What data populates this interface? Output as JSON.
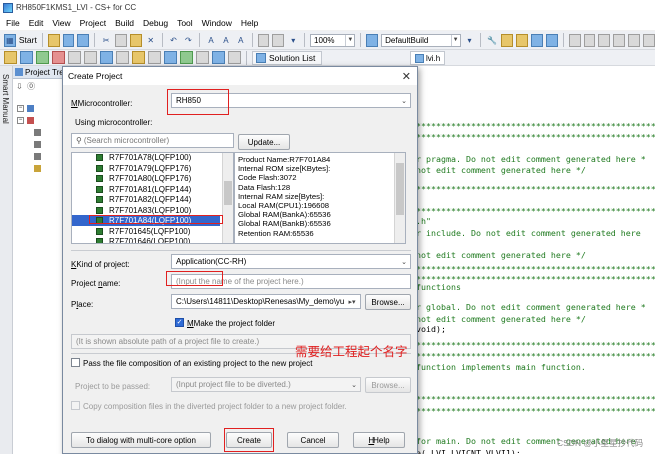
{
  "window": {
    "title": "RH850F1KMS1_LVI - CS+ for CC"
  },
  "menu": [
    "File",
    "Edit",
    "View",
    "Project",
    "Build",
    "Debug",
    "Tool",
    "Window",
    "Help"
  ],
  "toolbar": {
    "start_label": "Start",
    "zoom_value": "100%",
    "build_config": "DefaultBuild"
  },
  "toolbar2": {
    "solution_list_label": "Solution List"
  },
  "sidebar": {
    "smart_manual": "Smart Manual",
    "project_tree_title": "Project Tree"
  },
  "editor_tab": {
    "label": "lvi.h"
  },
  "dialog": {
    "title": "Create Project",
    "microcontroller_label": "Microcontroller:",
    "microcontroller_value": "RH850",
    "using_mc_label": "Using microcontroller:",
    "search_placeholder": "(Search microcontroller)",
    "update_button": "Update...",
    "devices": [
      "R7F701A78(LQFP100)",
      "R7F701A79(LQFP176)",
      "R7F701A80(LQFP176)",
      "R7F701A81(LQFP144)",
      "R7F701A82(LQFP144)",
      "R7F701A83(LQFP100)",
      "R7F701A84(LQFP100)",
      "R7F701645(LQFP100)",
      "R7F701646(LQFP100)"
    ],
    "selected_device_index": 6,
    "info_lines": [
      "Product Name:R7F701A84",
      "Internal ROM size[KBytes]:",
      "  Code Flash:3072",
      "  Data Flash:128",
      "Internal RAM size[Bytes]:",
      "  Local RAM(CPU1):196608",
      "  Global RAM(BankA):65536",
      "  Global RAM(BankB):65536",
      "  Retention RAM:65536"
    ],
    "kind_label": "Kind of project:",
    "kind_value": "Application(CC-RH)",
    "project_name_label": "Project name:",
    "project_name_placeholder": "(Input the name of the project here.)",
    "place_label": "Place:",
    "place_value": "C:\\Users\\14811\\Desktop\\Renesas\\My_demo\\yu",
    "browse_button": "Browse...",
    "make_folder_label": "Make the project folder",
    "make_folder_checked": true,
    "abs_path_note": "(It is shown absolute path of a project file to create.)",
    "pass_composition_label": "Pass the file composition of an existing project to the new project",
    "pass_composition_checked": false,
    "project_to_pass_label": "Project to be passed:",
    "project_to_pass_placeholder": "(Input project file to be diverted.)",
    "browse2_button": "Browse...",
    "copy_files_label": "Copy composition files in the diverted project folder to a new project folder.",
    "multicore_button": "To dialog with multi-core option",
    "create_button": "Create",
    "cancel_button": "Cancel",
    "help_button": "Help"
  },
  "annotation": {
    "text": "需要给工程起个名字"
  },
  "code_lines": [
    {
      "text": "r pragma. Do not edit comment generated here *",
      "kind": "cmt"
    },
    {
      "text": "not edit comment generated here */",
      "kind": "cmt"
    },
    {
      "text": ".h\"",
      "kind": "cmt"
    },
    {
      "text": "r include. Do not edit comment generated here",
      "kind": "cmt"
    },
    {
      "text": "not edit comment generated here */",
      "kind": "cmt"
    },
    {
      "text": "functions",
      "kind": "cmt"
    },
    {
      "text": "r global. Do not edit comment generated here *",
      "kind": "cmt"
    },
    {
      "text": "not edit comment generated here */",
      "kind": "cmt"
    },
    {
      "text": "void);",
      "kind": "txt"
    },
    {
      "text": "function implements main function.",
      "kind": "cmt"
    },
    {
      "text": "for main. Do not edit comment generated here",
      "kind": "cmt"
    },
    {
      "text": "e(_LVI_LVICNT_VLVI1);",
      "kind": "txt"
    }
  ],
  "watermark": "CSDN @小星星抄代码"
}
